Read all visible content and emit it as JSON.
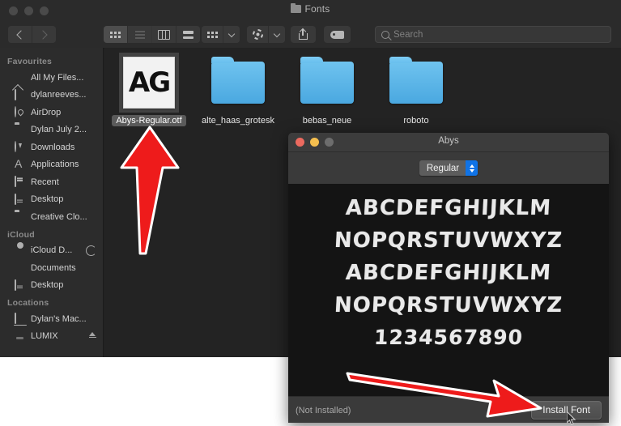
{
  "finder": {
    "title": "Fonts",
    "title_icon": "folder-icon",
    "window_controls": [
      "close-inactive",
      "minimize-inactive",
      "zoom-inactive"
    ],
    "toolbar": {
      "back_icon": "chevron-left-icon",
      "forward_icon": "chevron-right-icon",
      "view_icon_label": "icon-view-icon",
      "view_list_label": "list-view-icon",
      "view_column_label": "column-view-icon",
      "view_gallery_label": "gallery-view-icon",
      "group_icon": "group-by-icon",
      "group_chevron": "chevron-down-icon",
      "action_icon": "gear-icon",
      "action_chevron": "chevron-down-icon",
      "share_icon": "share-icon",
      "tag_icon": "tag-icon"
    },
    "search": {
      "placeholder": "Search",
      "icon": "search-icon",
      "value": ""
    },
    "sidebar": {
      "sections": [
        {
          "header": "Favourites",
          "items": [
            {
              "label": "All My Files...",
              "icon": "document-icon"
            },
            {
              "label": "dylanreeves...",
              "icon": "home-icon"
            },
            {
              "label": "AirDrop",
              "icon": "airdrop-icon"
            },
            {
              "label": "Dylan July 2...",
              "icon": "folder-icon"
            },
            {
              "label": "Downloads",
              "icon": "downloads-icon"
            },
            {
              "label": "Applications",
              "icon": "applications-icon"
            },
            {
              "label": "Recent",
              "icon": "recent-icon"
            },
            {
              "label": "Desktop",
              "icon": "desktop-icon"
            },
            {
              "label": "Creative Clo...",
              "icon": "folder-icon"
            }
          ]
        },
        {
          "header": "iCloud",
          "items": [
            {
              "label": "iCloud D...",
              "icon": "cloud-icon",
              "accessory": "sync-spinner"
            },
            {
              "label": "Documents",
              "icon": "documents-icon"
            },
            {
              "label": "Desktop",
              "icon": "desktop-icon"
            }
          ]
        },
        {
          "header": "Locations",
          "items": [
            {
              "label": "Dylan's Mac...",
              "icon": "computer-icon"
            },
            {
              "label": "LUMIX",
              "icon": "drive-icon",
              "accessory": "eject-icon"
            }
          ]
        }
      ]
    },
    "files": [
      {
        "name": "Abys-Regular.otf",
        "type": "font",
        "glyphs": "AG",
        "selected": true
      },
      {
        "name": "alte_haas_grotesk",
        "type": "folder",
        "selected": false
      },
      {
        "name": "bebas_neue",
        "type": "folder",
        "selected": false
      },
      {
        "name": "roboto",
        "type": "folder",
        "selected": false
      }
    ]
  },
  "abys_window": {
    "title": "Abys",
    "window_controls": [
      "close",
      "minimize",
      "zoom-disabled"
    ],
    "style_popup": {
      "value": "Regular",
      "options": [
        "Regular"
      ]
    },
    "preview_lines": [
      "ABCDEFGHIJKLM",
      "NOPQRSTUVWXYZ",
      "ABCDEFGHIJKLM",
      "NOPQRSTUVWXYZ",
      "1234567890"
    ],
    "install_status": "(Not Installed)",
    "install_button": "Install Font"
  },
  "annotations": {
    "arrow_to_file": "red-arrow-up-icon",
    "arrow_to_install": "red-arrow-down-right-icon",
    "cursor": "mouse-pointer-icon"
  },
  "colors": {
    "finder_bg": "#232323",
    "sidebar_bg": "#2c2c2c",
    "toolbar_bg": "#2b2b2b",
    "abys_bg": "#3a3a3a",
    "preview_bg": "#141414",
    "folder_blue": "#4aa8e0",
    "accent_blue": "#1073e6",
    "annotation_red": "#ee1b1b"
  }
}
